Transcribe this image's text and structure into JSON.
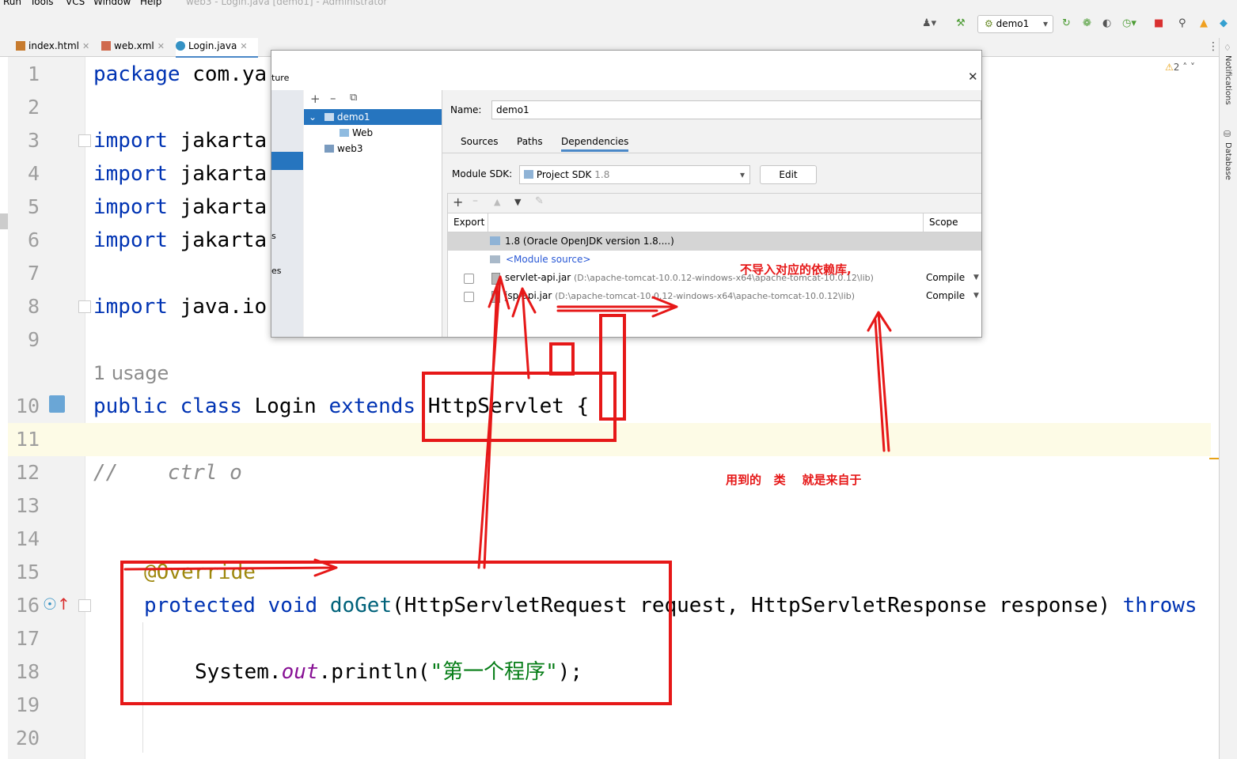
{
  "menubar": {
    "items": [
      "Run",
      "Tools",
      "VCS",
      "Window",
      "Help"
    ],
    "window_title": "web3 - Login.java [demo1] - Administrator"
  },
  "toolbar": {
    "run_config": "demo1",
    "icons": [
      "user-icon",
      "hammer-icon",
      "run-icon",
      "debug-icon",
      "coverage-icon",
      "profile-icon",
      "stop-icon",
      "search-icon",
      "update-icon",
      "plugin-icon"
    ]
  },
  "tabs": [
    {
      "label": "index.html",
      "active": false
    },
    {
      "label": "web.xml",
      "active": false
    },
    {
      "label": "Login.java",
      "active": true
    }
  ],
  "editor": {
    "warnings": "2",
    "usage_hint": "1 usage",
    "lines": [
      {
        "n": "1",
        "text": "package com.ya"
      },
      {
        "n": "2",
        "text": ""
      },
      {
        "n": "3",
        "kw": "import",
        "rest": " jakarta"
      },
      {
        "n": "4",
        "kw": "import",
        "rest": " jakarta"
      },
      {
        "n": "5",
        "kw": "import",
        "rest": " jakarta"
      },
      {
        "n": "6",
        "kw": "import",
        "rest": " jakarta"
      },
      {
        "n": "7",
        "text": ""
      },
      {
        "n": "8",
        "kw": "import",
        "rest": " java.io"
      },
      {
        "n": "9",
        "text": ""
      },
      {
        "n": "10",
        "text": "public class Login extends HttpServlet {"
      },
      {
        "n": "11",
        "text": ""
      },
      {
        "n": "12",
        "text": "//    ctrl o"
      },
      {
        "n": "13",
        "text": ""
      },
      {
        "n": "14",
        "text": ""
      },
      {
        "n": "15",
        "text": "@Override"
      },
      {
        "n": "16",
        "text": "protected void doGet(HttpServletRequest request, HttpServletResponse response) throws"
      },
      {
        "n": "17",
        "text": ""
      },
      {
        "n": "18",
        "text": "System.out.println(\"第一个程序\");"
      },
      {
        "n": "19",
        "text": ""
      },
      {
        "n": "20",
        "text": ""
      }
    ],
    "line10": {
      "kw1": "public",
      "kw2": "class",
      "name": "Login",
      "kw3": "extends",
      "sup": "HttpServlet {"
    },
    "line12": {
      "comment": "//    ctrl o"
    },
    "line15": {
      "annotation": "@Override"
    },
    "line16": {
      "kw1": "protected",
      "kw2": "void",
      "method": "doGet",
      "params": "(HttpServletRequest request, HttpServletResponse response) ",
      "kw3": "throws"
    },
    "line18": {
      "pre": "System.",
      "field": "out",
      "mid": ".println(",
      "str": "\"第一个程序\"",
      "end": ");"
    }
  },
  "right_strip": {
    "notifications": "Notifications",
    "database": "Database"
  },
  "dialog": {
    "title_fragment": "ture",
    "left_fragment": "s",
    "left_fragment2": "es",
    "tree": [
      {
        "label": "demo1",
        "selected": true
      },
      {
        "label": "Web",
        "selected": false
      },
      {
        "label": "web3",
        "selected": false
      }
    ],
    "name_label": "Name:",
    "name_value": "demo1",
    "tabs": [
      "Sources",
      "Paths",
      "Dependencies"
    ],
    "active_tab": "Dependencies",
    "sdk_label": "Module SDK:",
    "sdk_value": "Project SDK",
    "sdk_version": "1.8",
    "edit_button": "Edit",
    "table_headers": {
      "export": "Export",
      "scope": "Scope"
    },
    "deps": [
      {
        "name": "1.8 (Oracle OpenJDK version 1.8....)",
        "path": "",
        "scope": "",
        "checkbox": false,
        "selected": true
      },
      {
        "name": "<Module source>",
        "path": "",
        "scope": "",
        "checkbox": false,
        "selected": false
      },
      {
        "name": "servlet-api.jar",
        "path": "(D:\\apache-tomcat-10.0.12-windows-x64\\apache-tomcat-10.0.12\\lib)",
        "scope": "Compile",
        "checkbox": true,
        "selected": false
      },
      {
        "name": "jsp-api.jar",
        "path": "(D:\\apache-tomcat-10.0.12-windows-x64\\apache-tomcat-10.0.12\\lib)",
        "scope": "Compile",
        "checkbox": true,
        "selected": false
      }
    ]
  },
  "annotations": {
    "note1": "不导入对应的依赖库,",
    "note2": "用到的   类    就是来自于",
    "color": "#e61818"
  }
}
